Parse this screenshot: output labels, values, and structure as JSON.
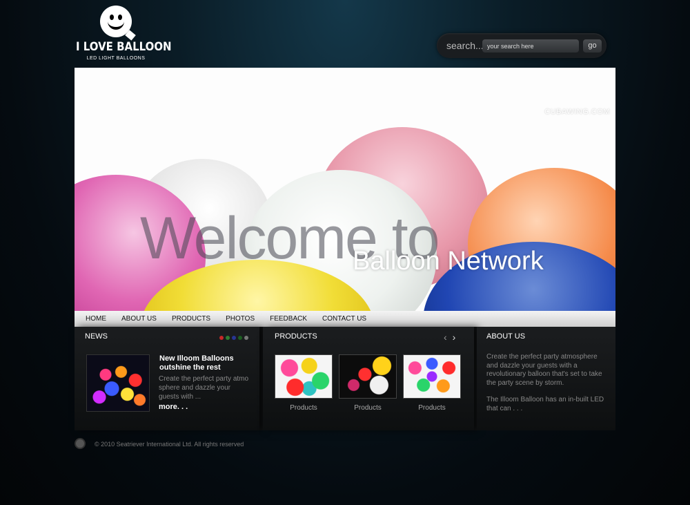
{
  "header": {
    "logo_title": "I LOVE BALLOON",
    "logo_subtitle": "LED LIGHT BALLOONS",
    "search_label": "search...",
    "search_placeholder": "your search here",
    "search_button": "go"
  },
  "hero": {
    "watermark": "CUBAWING.COM",
    "headline_faded": "Welcome to",
    "headline": "Balloon Network"
  },
  "nav": {
    "items": [
      {
        "label": "HOME"
      },
      {
        "label": "ABOUT US"
      },
      {
        "label": "PRODUCTS"
      },
      {
        "label": "PHOTOS"
      },
      {
        "label": "FEEDBACK"
      },
      {
        "label": "CONTACT US"
      }
    ]
  },
  "news": {
    "title": "NEWS",
    "dot_colors": [
      "#c62828",
      "#2e7d32",
      "#283593",
      "#1b5e20",
      "#777777"
    ],
    "headline": "New Illoom Balloons outshine the rest",
    "body": "Create the perfect party atmo sphere and dazzle your guests with ...",
    "more": "more. . ."
  },
  "products": {
    "title": "PRODUCTS",
    "prev_icon": "chevron-left-icon",
    "next_icon": "chevron-right-icon",
    "items": [
      {
        "label": "Products"
      },
      {
        "label": "Products"
      },
      {
        "label": "Products"
      }
    ]
  },
  "about": {
    "title": "ABOUT US",
    "para1": "Create the perfect party atmosphere and dazzle your guests with a revolutionary balloon that's set to take the party scene by storm.",
    "para2": "The Illoom Balloon has an in-built LED that can . . ."
  },
  "footer": {
    "copyright": "© 2010  Seatriever International Ltd. All rights reserved"
  }
}
